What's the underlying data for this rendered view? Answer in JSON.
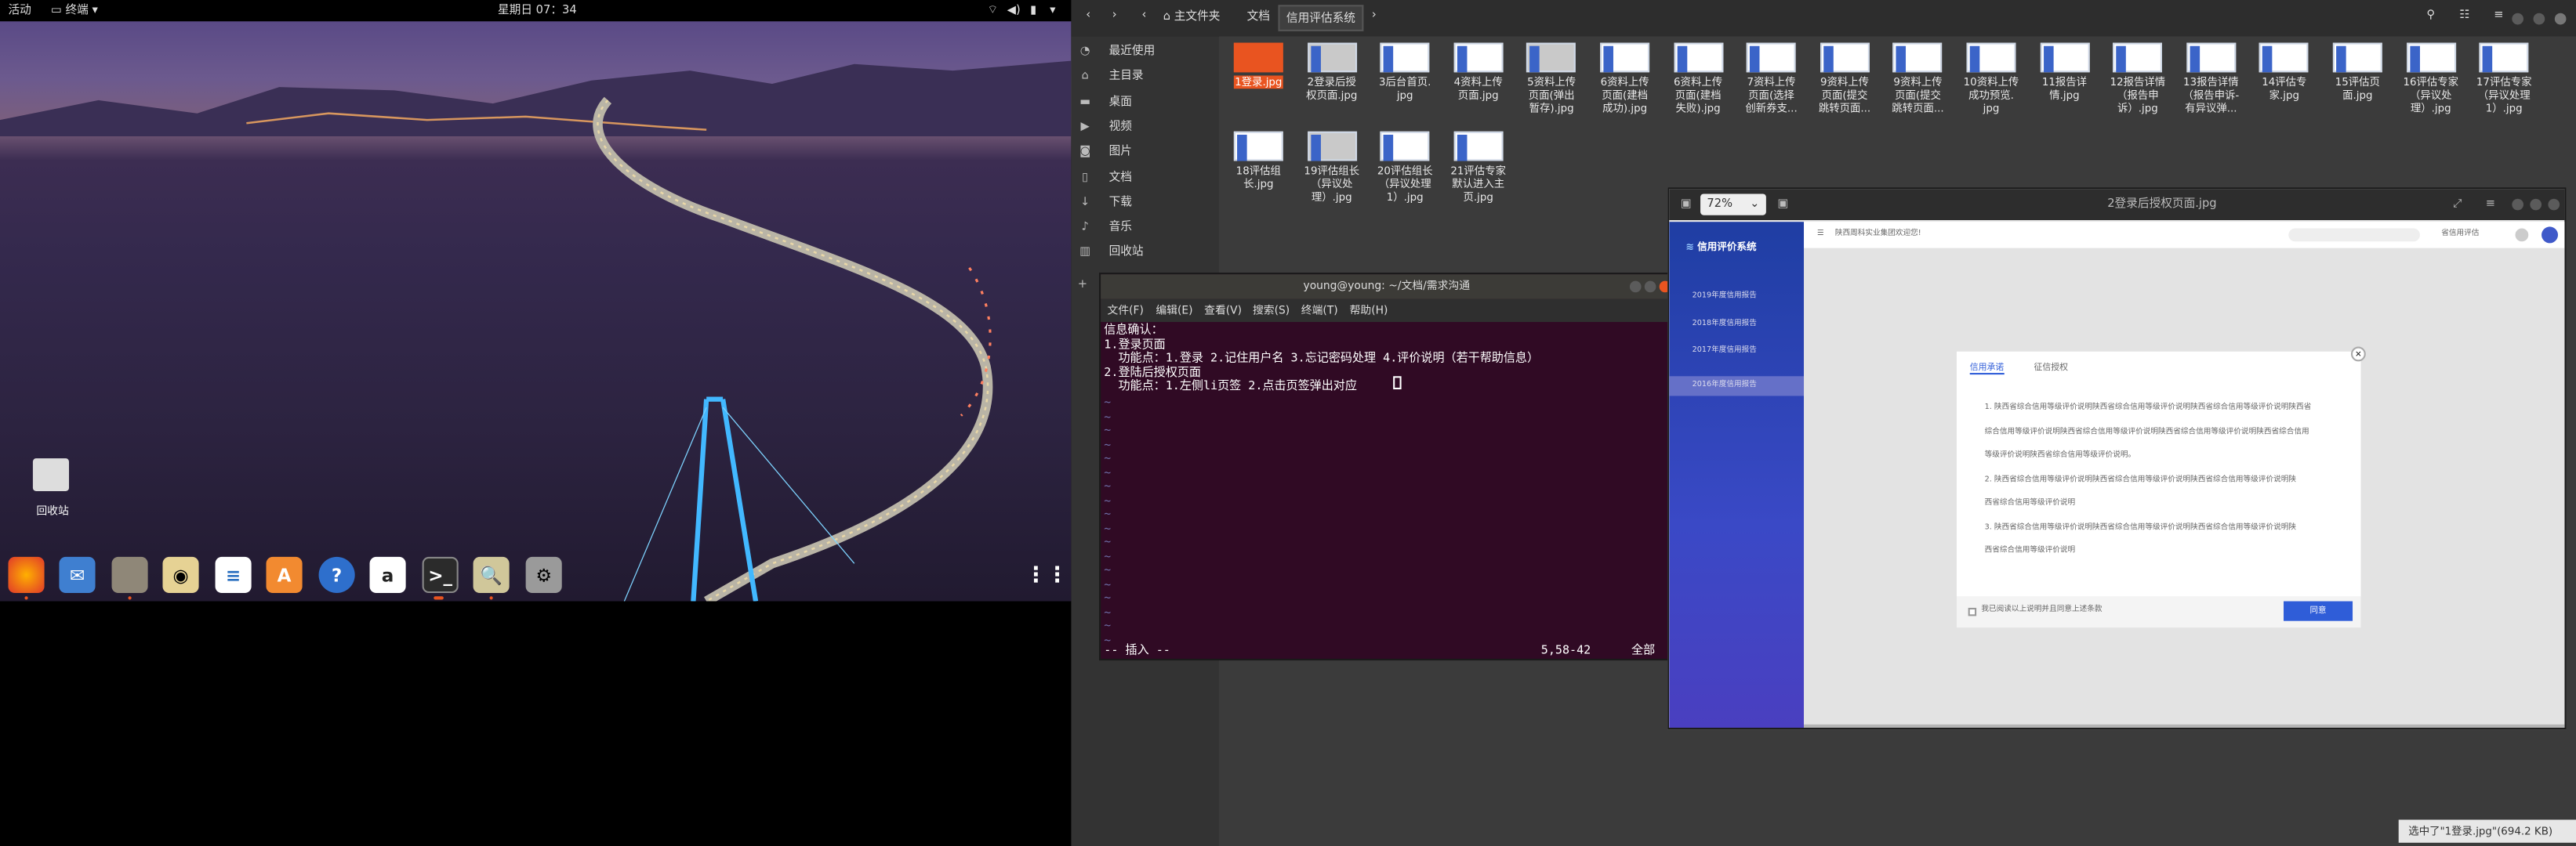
{
  "topbar": {
    "activities": "活动",
    "app": "终端",
    "clock": "星期日 07：34"
  },
  "desktop": {
    "trash_label": "回收站"
  },
  "dock": [
    "firefox-icon",
    "thunderbird-icon",
    "files-icon",
    "rhythmbox-icon",
    "writer-icon",
    "software-icon",
    "help-icon",
    "amazon-icon",
    "terminal-icon",
    "image-viewer-icon",
    "settings-icon"
  ],
  "files": {
    "breadcrumb": [
      "主文件夹",
      "文档",
      "信用评估系统"
    ],
    "sidebar": [
      {
        "icon": "clock-icon",
        "label": "最近使用"
      },
      {
        "icon": "home-icon",
        "label": "主目录"
      },
      {
        "icon": "folder-icon",
        "label": "桌面"
      },
      {
        "icon": "video-icon",
        "label": "视频"
      },
      {
        "icon": "camera-icon",
        "label": "图片"
      },
      {
        "icon": "document-icon",
        "label": "文档"
      },
      {
        "icon": "download-icon",
        "label": "下载"
      },
      {
        "icon": "music-icon",
        "label": "音乐"
      },
      {
        "icon": "trash-icon",
        "label": "回收站"
      }
    ],
    "add_label": "+",
    "items": [
      {
        "l1": "1登录.jpg",
        "sel": true
      },
      {
        "l1": "2登录后授",
        "l2": "权页面.jpg"
      },
      {
        "l1": "3后台首页.",
        "l2": "jpg"
      },
      {
        "l1": "4资料上传",
        "l2": "页面.jpg"
      },
      {
        "l1": "5资料上传",
        "l2": "页面(弹出",
        "l3": "暂存).jpg"
      },
      {
        "l1": "6资料上传",
        "l2": "页面(建档",
        "l3": "成功).jpg"
      },
      {
        "l1": "6资料上传",
        "l2": "页面(建档",
        "l3": "失败).jpg"
      },
      {
        "l1": "7资料上传",
        "l2": "页面(选择",
        "l3": "创新券支..."
      },
      {
        "l1": "9资料上传",
        "l2": "页面(提交",
        "l3": "跳转页面..."
      },
      {
        "l1": "9资料上传",
        "l2": "页面(提交",
        "l3": "跳转页面..."
      },
      {
        "l1": "10资料上传",
        "l2": "成功预览.",
        "l3": "jpg"
      },
      {
        "l1": "11报告详",
        "l2": "情.jpg"
      },
      {
        "l1": "12报告详情",
        "l2": "（报告申",
        "l3": "诉）.jpg"
      },
      {
        "l1": "13报告详情",
        "l2": "（报告申诉-",
        "l3": "有异议弹..."
      },
      {
        "l1": "14评估专",
        "l2": "家.jpg"
      },
      {
        "l1": "15评估页",
        "l2": "面.jpg"
      },
      {
        "l1": "16评估专家",
        "l2": "（异议处",
        "l3": "理）.jpg"
      },
      {
        "l1": "17评估专家",
        "l2": "（异议处理",
        "l3": "1）.jpg"
      },
      {
        "l1": "18评估组",
        "l2": "长.jpg"
      },
      {
        "l1": "19评估组长",
        "l2": "（异议处",
        "l3": "理）.jpg"
      },
      {
        "l1": "20评估组长",
        "l2": "（异议处理",
        "l3": "1）.jpg"
      },
      {
        "l1": "21评估专家",
        "l2": "默认进入主",
        "l3": "页.jpg"
      }
    ],
    "status": "选中了\"1登录.jpg\"(694.2 KB)"
  },
  "terminal": {
    "title": "young@young: ~/文档/需求沟通",
    "menu": [
      "文件(F)",
      "编辑(E)",
      "查看(V)",
      "搜索(S)",
      "终端(T)",
      "帮助(H)"
    ],
    "lines": [
      "信息确认：",
      "1.登录页面",
      "  功能点：1.登录 2.记住用户名 3.忘记密码处理 4.评价说明（若干帮助信息）",
      "2.登陆后授权页面",
      "  功能点：1.左侧li页签 2.点击页签弹出对应"
    ],
    "tilde": "~",
    "mode": "-- 插入 --",
    "pos": "5,58-42",
    "all": "全部"
  },
  "viewer": {
    "zoom": "72%",
    "title": "2登录后授权页面.jpg",
    "brand": "信用评价系统",
    "company": "陕西周科实业集团欢迎您!",
    "user_label": "省信用评估",
    "nav": [
      "2019年度信用报告",
      "2018年度信用报告",
      "2017年度信用报告",
      "2016年度信用报告"
    ],
    "tabs": [
      "信用承诺",
      "征信授权"
    ],
    "p1": [
      "1. 陕西省综合信用等级评价说明陕西省综合信用等级评价说明陕西省综合信用等级评价说明陕西省",
      "综合信用等级评价说明陕西省综合信用等级评价说明陕西省综合信用等级评价说明陕西省综合信用",
      "等级评价说明陕西省综合信用等级评价说明。"
    ],
    "p2": [
      "2. 陕西省综合信用等级评价说明陕西省综合信用等级评价说明陕西省综合信用等级评价说明陕",
      "西省综合信用等级评价说明"
    ],
    "p3": [
      "3. 陕西省综合信用等级评价说明陕西省综合信用等级评价说明陕西省综合信用等级评价说明陕",
      "西省综合信用等级评价说明"
    ],
    "agree": "我已阅读以上说明并且同意上述条款",
    "confirm": "同意"
  }
}
